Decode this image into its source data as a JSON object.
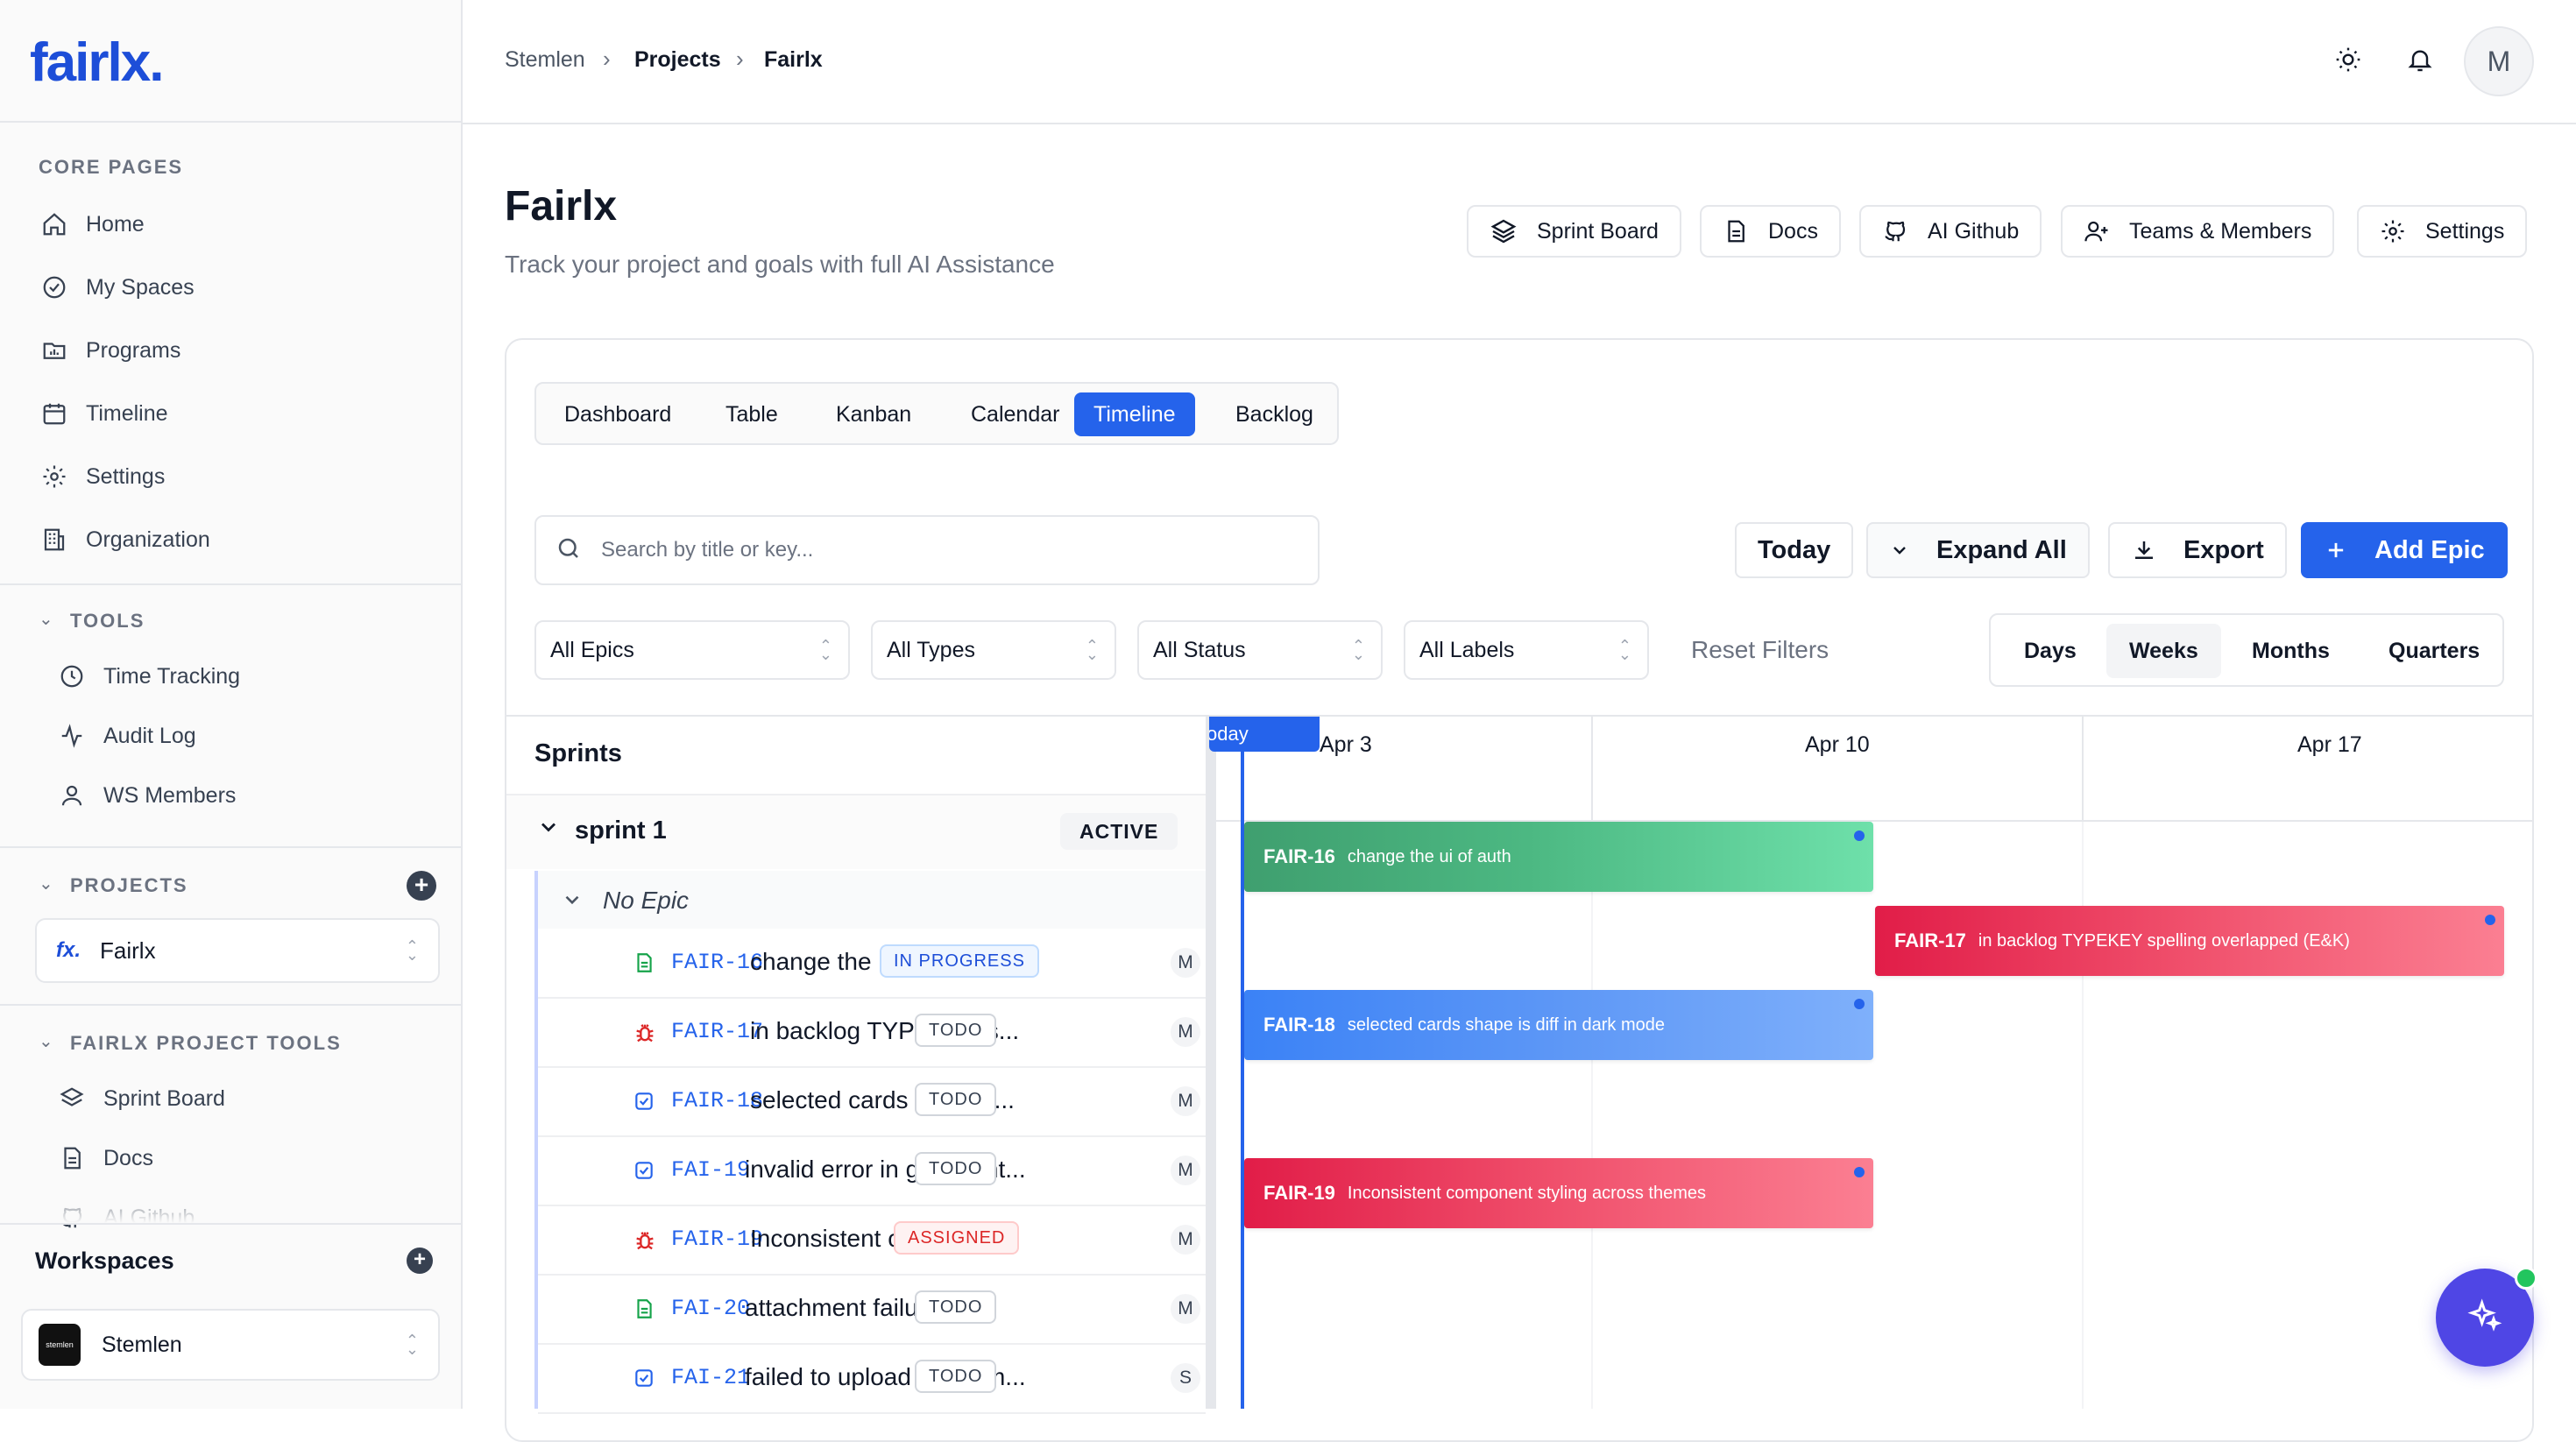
{
  "app": {
    "logo": "fairlx."
  },
  "sidebar": {
    "core_title": "CORE PAGES",
    "core_items": [
      {
        "label": "Home"
      },
      {
        "label": "My Spaces"
      },
      {
        "label": "Programs"
      },
      {
        "label": "Timeline"
      },
      {
        "label": "Settings"
      },
      {
        "label": "Organization"
      }
    ],
    "tools_title": "TOOLS",
    "tools_items": [
      {
        "label": "Time Tracking"
      },
      {
        "label": "Audit Log"
      },
      {
        "label": "WS Members"
      }
    ],
    "projects_title": "PROJECTS",
    "project_select": {
      "logo": "fx.",
      "label": "Fairlx"
    },
    "project_tools_title": "FAIRLX PROJECT TOOLS",
    "project_tools_items": [
      {
        "label": "Sprint Board"
      },
      {
        "label": "Docs"
      },
      {
        "label": "AI Github"
      }
    ],
    "workspaces_title": "Workspaces",
    "workspace_select": {
      "logo": "stemlen",
      "label": "Stemlen"
    }
  },
  "topbar": {
    "breadcrumb": [
      "Stemlen",
      "Projects",
      "Fairlx"
    ],
    "avatar": "M"
  },
  "header": {
    "title": "Fairlx",
    "subtitle": "Track your project and goals with full AI Assistance",
    "buttons": [
      "Sprint Board",
      "Docs",
      "AI Github",
      "Teams & Members",
      "Settings"
    ]
  },
  "tabs": [
    "Dashboard",
    "Table",
    "Kanban",
    "Calendar",
    "Timeline",
    "Backlog"
  ],
  "active_tab": "Timeline",
  "toolbar": {
    "search_placeholder": "Search by title or key...",
    "today": "Today",
    "expand_all": "Expand All",
    "export": "Export",
    "add_epic": "Add Epic"
  },
  "filters": {
    "epics": "All Epics",
    "types": "All Types",
    "status": "All Status",
    "labels": "All Labels",
    "reset": "Reset Filters"
  },
  "scale": {
    "options": [
      "Days",
      "Weeks",
      "Months",
      "Quarters"
    ],
    "selected": "Weeks"
  },
  "sprints": {
    "heading": "Sprints",
    "sprint_name": "sprint 1",
    "sprint_status": "ACTIVE",
    "epic_group": "No Epic",
    "tasks": [
      {
        "key": "FAIR-16",
        "title": "change the ui of ...",
        "status": "IN PROGRESS",
        "assignee": "M",
        "type": "doc"
      },
      {
        "key": "FAIR-17",
        "title": "in backlog TYPEKEY s...",
        "status": "TODO",
        "assignee": "M",
        "type": "bug"
      },
      {
        "key": "FAIR-18",
        "title": "selected cards shape i...",
        "status": "TODO",
        "assignee": "M",
        "type": "task"
      },
      {
        "key": "FAI-19",
        "title": "invalid error in github int...",
        "status": "TODO",
        "assignee": "M",
        "type": "task"
      },
      {
        "key": "FAIR-19",
        "title": "Inconsistent compo...",
        "status": "ASSIGNED",
        "assignee": "M",
        "type": "bug"
      },
      {
        "key": "FAI-20",
        "title": "attachment failure",
        "status": "TODO",
        "assignee": "M",
        "type": "doc"
      },
      {
        "key": "FAI-21",
        "title": "failed to upload attachm...",
        "status": "TODO",
        "assignee": "S",
        "type": "task"
      }
    ]
  },
  "timeline": {
    "today_label": "Today",
    "weeks": [
      "Apr 3",
      "Apr 10",
      "Apr 17"
    ],
    "bars": [
      {
        "key": "FAIR-16",
        "title": "change the ui of auth",
        "color": "green"
      },
      {
        "key": "FAIR-17",
        "title": "in backlog TYPEKEY spelling overlapped (E&K)",
        "color": "red"
      },
      {
        "key": "FAIR-18",
        "title": "selected cards shape is diff in dark mode",
        "color": "blue"
      },
      {
        "key": "FAIR-19",
        "title": "Inconsistent component styling across themes",
        "color": "red"
      }
    ]
  },
  "colors": {
    "primary": "#2563eb",
    "logo": "#1d4ed8",
    "ai_button": "#4f46e5",
    "online": "#22c55e"
  }
}
